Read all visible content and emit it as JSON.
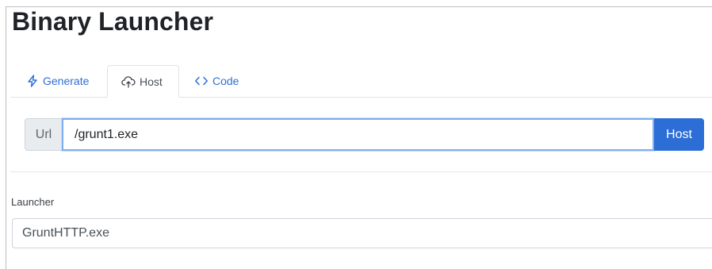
{
  "page": {
    "title": "Binary Launcher"
  },
  "tabs": [
    {
      "label": "Generate",
      "icon": "lightning-icon",
      "active": false
    },
    {
      "label": "Host",
      "icon": "cloud-upload-icon",
      "active": true
    },
    {
      "label": "Code",
      "icon": "code-brackets-icon",
      "active": false
    }
  ],
  "host_form": {
    "url_addon": "Url",
    "url_value": "/grunt1.exe",
    "host_button": "Host"
  },
  "launcher": {
    "label": "Launcher",
    "value": "GruntHTTP.exe"
  },
  "colors": {
    "accent": "#2c6ed5",
    "link": "#2f6fd6",
    "focus_border": "#80aef2"
  }
}
